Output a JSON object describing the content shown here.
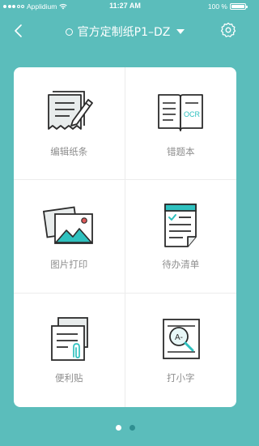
{
  "status_bar": {
    "carrier": "Applidium",
    "time": "11:27 AM",
    "battery": "100 %"
  },
  "nav": {
    "title": "官方定制纸P1–DZ",
    "back_icon": "chevron-left-icon",
    "settings_icon": "gear-icon"
  },
  "grid": {
    "items": [
      {
        "label": "编辑纸条",
        "icon": "edit-note-icon"
      },
      {
        "label": "错题本",
        "icon": "ocr-book-icon"
      },
      {
        "label": "图片打印",
        "icon": "picture-print-icon"
      },
      {
        "label": "待办清单",
        "icon": "todo-list-icon"
      },
      {
        "label": "便利贴",
        "icon": "sticky-note-icon"
      },
      {
        "label": "打小字",
        "icon": "magnifier-text-icon"
      }
    ]
  },
  "pager": {
    "pages": 2,
    "current": 1
  },
  "colors": {
    "background": "#5bbdbb",
    "accent": "#2fc1bf",
    "card": "#ffffff",
    "label": "#8e8e8e"
  }
}
